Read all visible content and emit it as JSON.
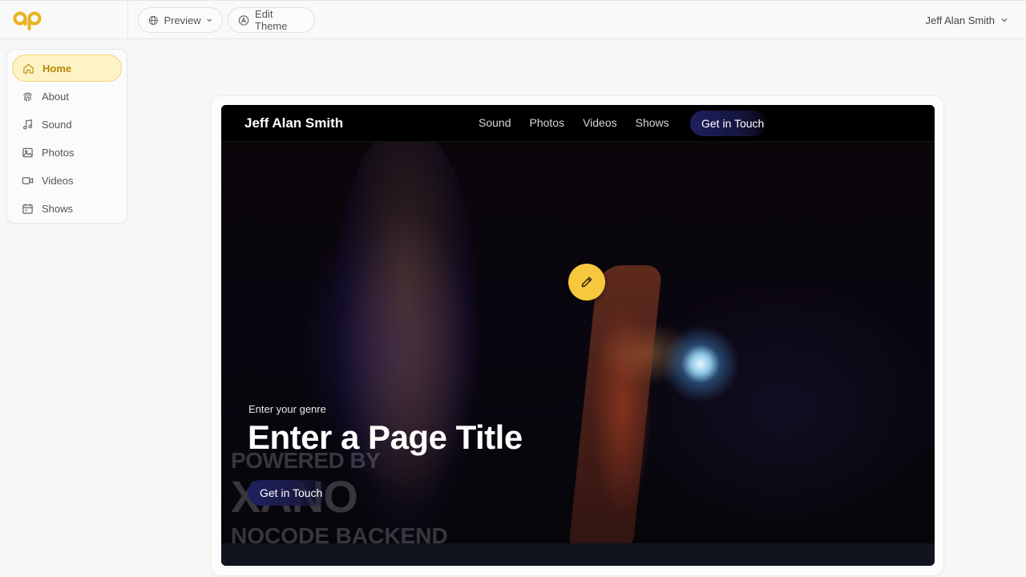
{
  "topbar": {
    "preview_label": "Preview",
    "edit_theme_label": "Edit Theme",
    "user_name": "Jeff Alan Smith"
  },
  "sidebar": {
    "items": [
      {
        "label": "Home",
        "icon": "home-icon",
        "active": true
      },
      {
        "label": "About",
        "icon": "fingerprint-icon",
        "active": false
      },
      {
        "label": "Sound",
        "icon": "music-note-icon",
        "active": false
      },
      {
        "label": "Photos",
        "icon": "image-icon",
        "active": false
      },
      {
        "label": "Videos",
        "icon": "video-camera-icon",
        "active": false
      },
      {
        "label": "Shows",
        "icon": "calendar-icon",
        "active": false
      }
    ]
  },
  "site": {
    "brand": "Jeff Alan Smith",
    "nav_links": [
      "Sound",
      "Photos",
      "Videos",
      "Shows"
    ],
    "nav_cta": "Get in Touch",
    "genre": "Enter your genre",
    "title": "Enter a Page Title",
    "hero_cta": "Get in Touch",
    "watermark": [
      "POWERED BY",
      "XANO",
      "NOCODE BACKEND"
    ]
  },
  "colors": {
    "accent": "#f5c83e",
    "active_bg": "#fdf3c6",
    "active_text": "#b8860b",
    "cta_bg": "#1f2060"
  }
}
